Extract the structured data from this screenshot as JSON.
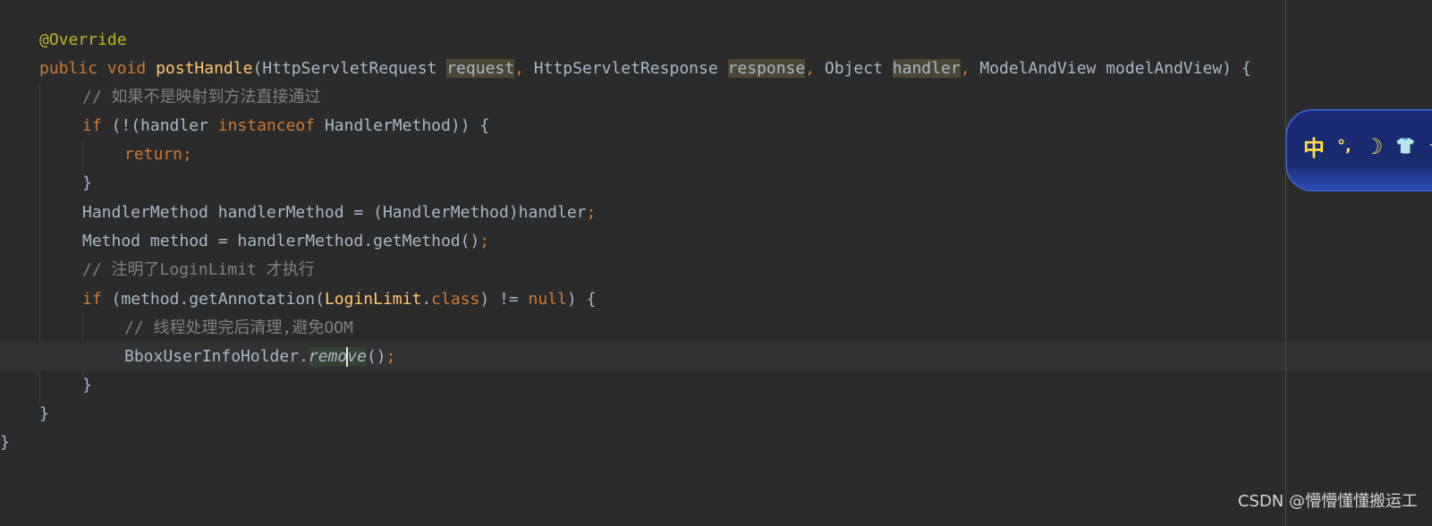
{
  "editor": {
    "language_accent": "#cc7832",
    "lines": [
      {
        "id": "l1",
        "annotation": "@Override"
      },
      {
        "id": "l2",
        "kw_public": "public",
        "kw_void": "void",
        "method_name": "postHandle",
        "p1_type": "HttpServletRequest",
        "p1_name": "request",
        "p2_type": "HttpServletResponse",
        "p2_name": "response",
        "p3_type": "Object",
        "p3_name": "handler",
        "p4_type": "ModelAndView",
        "p4_name": "modelAndView",
        "open": ") {"
      },
      {
        "id": "l3",
        "comment": "// 如果不是映射到方法直接通过"
      },
      {
        "id": "l4",
        "kw_if": "if",
        "open": " (!(handler ",
        "kw_instanceof": "instanceof",
        "rest": " HandlerMethod)) {"
      },
      {
        "id": "l5",
        "kw_return": "return",
        "semi": ";"
      },
      {
        "id": "l6",
        "brace": "}"
      },
      {
        "id": "l7",
        "text": "HandlerMethod handlerMethod = (HandlerMethod)handler",
        "semi": ";"
      },
      {
        "id": "l8",
        "text": "Method method = handlerMethod.getMethod()",
        "semi": ";"
      },
      {
        "id": "l9",
        "comment": "// 注明了LoginLimit 才执行"
      },
      {
        "id": "l10",
        "kw_if": "if",
        "p1": " (method.getAnnotation(",
        "cls": "LoginLimit",
        "dot": ".",
        "kw_class": "class",
        "p2": ") != ",
        "kw_null": "null",
        "p3": ") {"
      },
      {
        "id": "l11",
        "comment": "// 线程处理完后清理,避免OOM"
      },
      {
        "id": "l12",
        "text": "BboxUserInfoHolder.",
        "method_a": "remo",
        "method_b": "ve",
        "parens": "()",
        "semi": ";"
      },
      {
        "id": "l13",
        "brace": "}"
      },
      {
        "id": "l14",
        "brace": "}"
      },
      {
        "id": "l15",
        "brace": "}"
      }
    ]
  },
  "ime_toolbar": {
    "mode": "中",
    "icons": [
      "punctuation-icon",
      "moon-icon",
      "skin-icon",
      "star-icon"
    ],
    "punct": "°,",
    "moon": "☽",
    "shirt": "👕",
    "star": "★"
  },
  "watermark": {
    "text": "CSDN @懵懵懂懂搬运工"
  }
}
